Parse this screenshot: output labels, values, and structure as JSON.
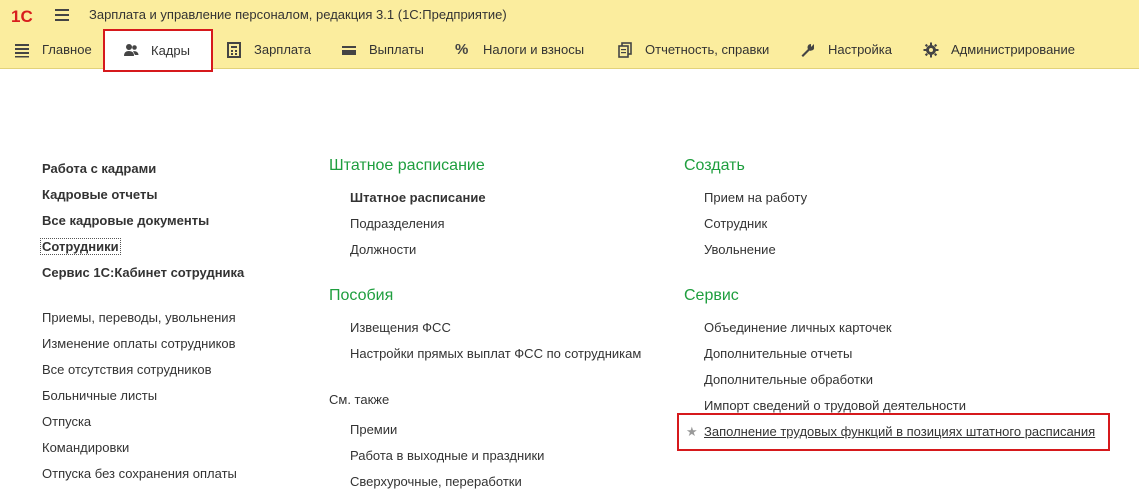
{
  "titlebar": {
    "logo_text": "1С",
    "title": "Зарплата и управление персоналом, редакция 3.1  (1С:Предприятие)"
  },
  "sections": [
    {
      "label": "Главное",
      "icon": "menu-list-icon"
    },
    {
      "label": "Кадры",
      "icon": "people-icon",
      "active": true
    },
    {
      "label": "Зарплата",
      "icon": "calculator-icon"
    },
    {
      "label": "Выплаты",
      "icon": "wallet-icon"
    },
    {
      "label": "Налоги и взносы",
      "icon": "percent-icon"
    },
    {
      "label": "Отчетность, справки",
      "icon": "documents-icon"
    },
    {
      "label": "Настройка",
      "icon": "wrench-icon"
    },
    {
      "label": "Администрирование",
      "icon": "gear-icon"
    }
  ],
  "left_column": {
    "main_links": [
      "Работа с кадрами",
      "Кадровые отчеты",
      "Все кадровые документы",
      "Сотрудники",
      "Сервис 1С:Кабинет сотрудника"
    ],
    "links": [
      "Приемы, переводы, увольнения",
      "Изменение оплаты сотрудников",
      "Все отсутствия сотрудников",
      "Больничные листы",
      "Отпуска",
      "Командировки",
      "Отпуска без сохранения оплаты"
    ]
  },
  "middle_column": {
    "staffing": {
      "title": "Штатное расписание",
      "items": [
        "Штатное расписание",
        "Подразделения",
        "Должности"
      ]
    },
    "benefits": {
      "title": "Пособия",
      "items": [
        "Извещения ФСС",
        "Настройки прямых выплат ФСС по сотрудникам"
      ]
    },
    "see_also": {
      "title": "См. также",
      "items": [
        "Премии",
        "Работа в выходные и праздники",
        "Сверхурочные, переработки"
      ]
    }
  },
  "right_column": {
    "create": {
      "title": "Создать",
      "items": [
        "Прием на работу",
        "Сотрудник",
        "Увольнение"
      ]
    },
    "service": {
      "title": "Сервис",
      "items": [
        "Объединение личных карточек",
        "Дополнительные отчеты",
        "Дополнительные обработки",
        "Импорт сведений о трудовой деятельности",
        "Заполнение трудовых функций в позициях штатного расписания"
      ],
      "starred_symbol": "★"
    }
  },
  "colors": {
    "panel_bg": "#fbed9e",
    "group_title": "#1e9e3e",
    "highlight_box": "#d6191c",
    "text": "#333333"
  }
}
